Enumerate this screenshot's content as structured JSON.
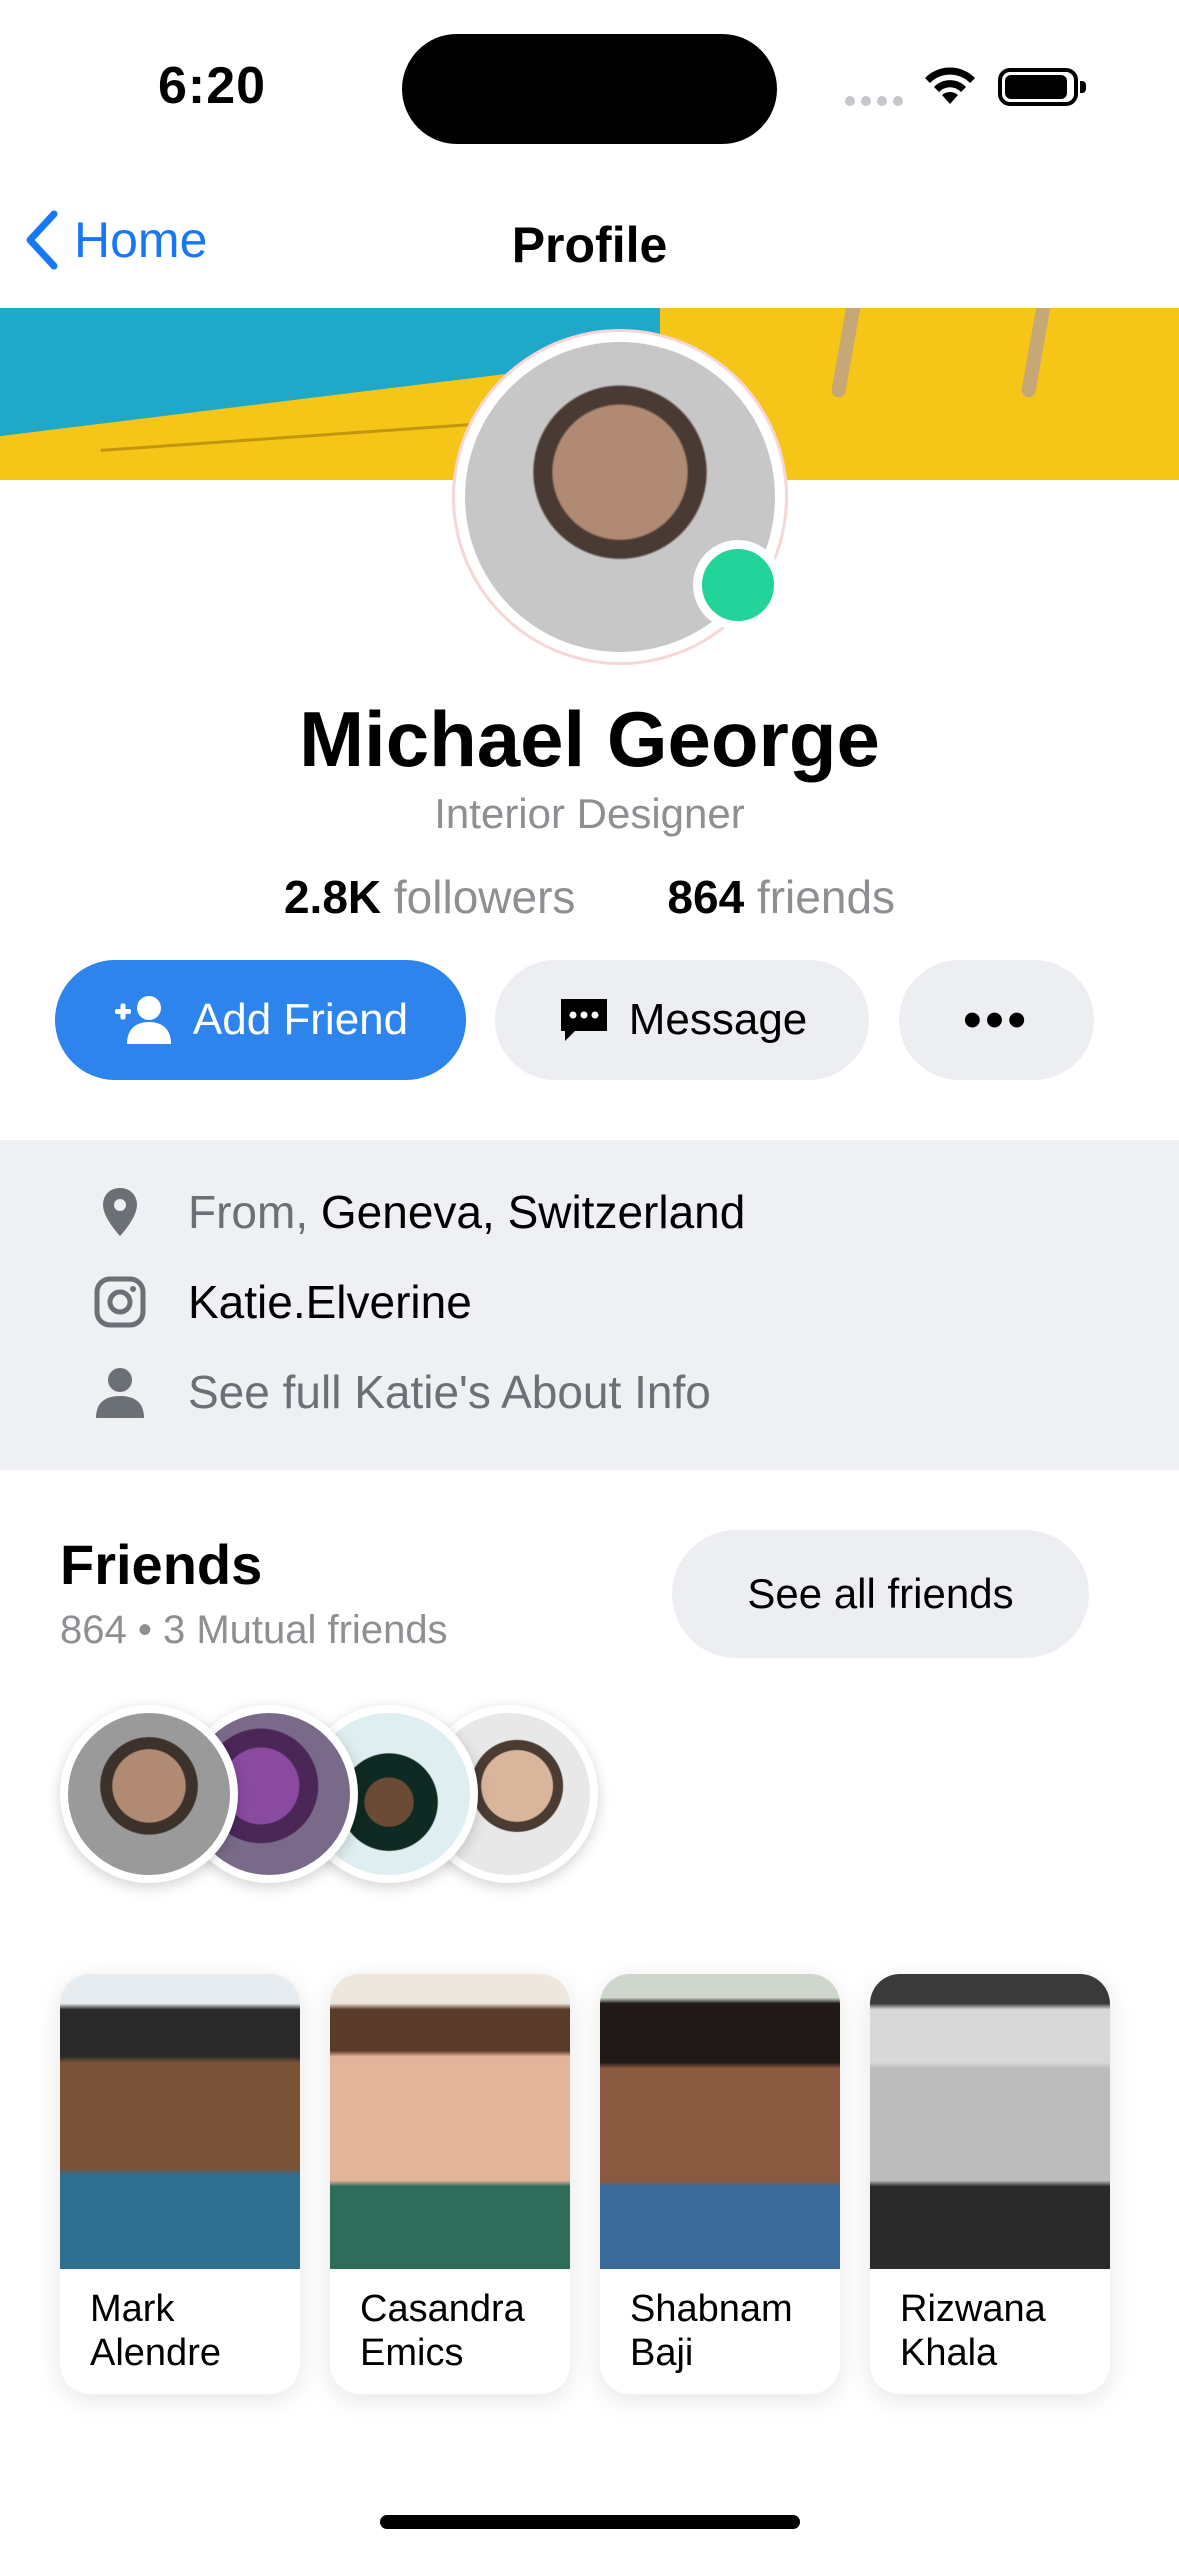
{
  "status_bar": {
    "time": "6:20"
  },
  "nav": {
    "back_label": "Home",
    "title": "Profile"
  },
  "profile": {
    "name": "Michael George",
    "role": "Interior Designer",
    "followers_count": "2.8K",
    "followers_label": "followers",
    "friends_count": "864",
    "friends_label": "friends",
    "online": true,
    "online_color": "#22d39a"
  },
  "actions": {
    "add_friend": "Add Friend",
    "message": "Message",
    "more": "•••"
  },
  "about": {
    "location_prefix": "From,",
    "location": "Geneva, Switzerland",
    "instagram": "Katie.Elverine",
    "about_link": "See full Katie's About Info"
  },
  "friends": {
    "title": "Friends",
    "subtitle": "864 • 3 Mutual friends",
    "see_all": "See all friends",
    "cards": [
      {
        "name": "Mark\nAlendre"
      },
      {
        "name": "Casandra\nEmics"
      },
      {
        "name": "Shabnam\nBaji"
      },
      {
        "name": "Rizwana\nKhala"
      }
    ]
  },
  "colors": {
    "accent": "#2d84ec",
    "link": "#1877f2",
    "muted": "#8e8e93",
    "section_bg": "#eef0f3"
  }
}
